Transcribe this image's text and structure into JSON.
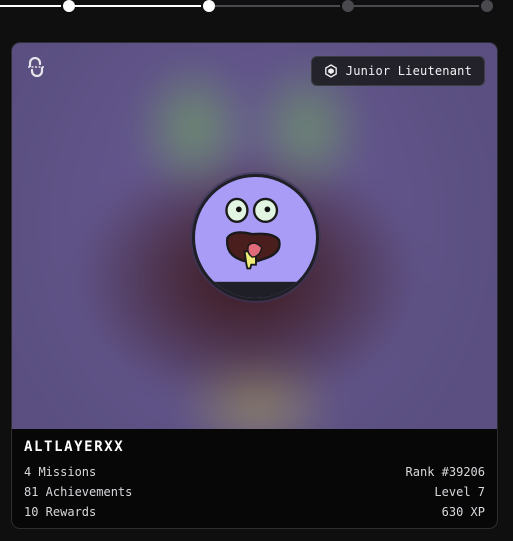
{
  "stepper": {
    "steps": [
      {
        "state": "completed"
      },
      {
        "state": "completed"
      },
      {
        "state": "current"
      },
      {
        "state": "upcoming"
      },
      {
        "state": "upcoming"
      }
    ],
    "colors": {
      "active": "#ffffff",
      "inactive": "#4a4a4e"
    }
  },
  "card": {
    "logo_icon": "link-loop-icon",
    "rank_badge": {
      "icon": "hexagon-badge-icon",
      "label": "Junior Lieutenant"
    },
    "avatar": {
      "icon": "smiley-monster-avatar",
      "bg_color": "#a99cf7"
    },
    "username": "ALTLAYERXX",
    "stats": {
      "missions": "4 Missions",
      "achievements": "81 Achievements",
      "rewards": "10 Rewards",
      "rank": "Rank #39206",
      "level": "Level 7",
      "xp": "630 XP"
    }
  }
}
